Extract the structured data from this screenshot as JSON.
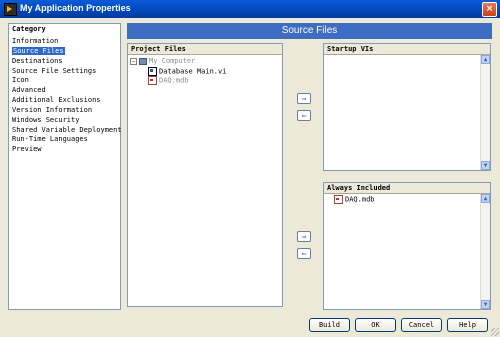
{
  "window": {
    "title": "My Application Properties",
    "close_glyph": "×"
  },
  "category": {
    "header": "Category",
    "items": [
      "Information",
      "Source Files",
      "Destinations",
      "Source File Settings",
      "Icon",
      "Advanced",
      "Additional Exclusions",
      "Version Information",
      "Windows Security",
      "Shared Variable Deployment",
      "Run-Time Languages",
      "Preview"
    ],
    "selected": "Source Files"
  },
  "main": {
    "title": "Source Files"
  },
  "project_files": {
    "header": "Project Files",
    "root": "My Computer",
    "children": [
      "Database Main.vi",
      "DAQ.mdb"
    ]
  },
  "startup_vis": {
    "header": "Startup VIs"
  },
  "always_included": {
    "header": "Always Included",
    "items": [
      "DAQ.mdb"
    ]
  },
  "arrows": {
    "add": "⇒",
    "remove": "⇐"
  },
  "scroll": {
    "up": "▲",
    "down": "▼"
  },
  "buttons": {
    "build": "Build",
    "ok": "OK",
    "cancel": "Cancel",
    "help": "Help"
  },
  "colors": {
    "title_bar": "#0a5bd8",
    "section_header": "#3e6cc2",
    "selection": "#316ac5"
  }
}
